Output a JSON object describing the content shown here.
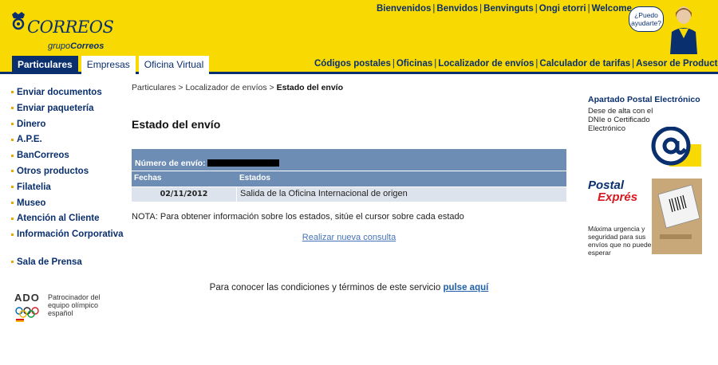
{
  "header": {
    "brand": "CORREOS",
    "group_prefix": "grupo",
    "group_name": "Correos",
    "languages": [
      "Bienvenidos",
      "Benvidos",
      "Benvinguts",
      "Ongi etorri",
      "Welcome"
    ],
    "help_bubble": "¿Puedo ayudarte?",
    "tabs": [
      "Particulares",
      "Empresas",
      "Oficina Virtual"
    ],
    "nav_links": [
      "Códigos postales",
      "Oficinas",
      "Localizador de envíos",
      "Calculador de tarifas",
      "Asesor de Productos"
    ]
  },
  "sidebar": {
    "items": [
      "Enviar documentos",
      "Enviar paquetería",
      "Dinero",
      "A.P.E.",
      "BanCorreos",
      "Otros productos",
      "Filatelia",
      "Museo",
      "Atención al Cliente",
      "Información Corporativa"
    ],
    "press": "Sala de Prensa",
    "ado": {
      "logo_text": "ADO",
      "description": "Patrocinador del equipo olímpico español"
    }
  },
  "main": {
    "breadcrumb": {
      "items": [
        "Particulares",
        "Localizador de envíos"
      ],
      "current": "Estado del envío",
      "separator": ">"
    },
    "title": "Estado del envío",
    "shipment_label": "Número de envío:",
    "columns": [
      "Fechas",
      "Estados"
    ],
    "rows": [
      {
        "date": "02/11/2012",
        "status": "Salida de la Oficina Internacional de origen"
      }
    ],
    "note": "NOTA: Para obtener información sobre los estados, sitúe el cursor sobre cada estado",
    "new_query": "Realizar nueva consulta",
    "terms_text": "Para conocer las condiciones y términos de este servicio",
    "terms_link": "pulse aquí"
  },
  "right": {
    "ad1": {
      "title": "Apartado Postal Electrónico",
      "description": "Dese de alta con el DNIe o Certificado Electrónico"
    },
    "ad2": {
      "title1": "Postal",
      "title2": "Exprés",
      "description": "Máxima urgencia y seguridad para sus envíos que no pueden esperar"
    }
  },
  "colors": {
    "brand_yellow": "#f9d902",
    "brand_blue": "#0a2f6e",
    "table_header": "#6d8db4",
    "table_row": "#dde3ec",
    "link": "#4473b8",
    "express_red": "#d71920"
  }
}
